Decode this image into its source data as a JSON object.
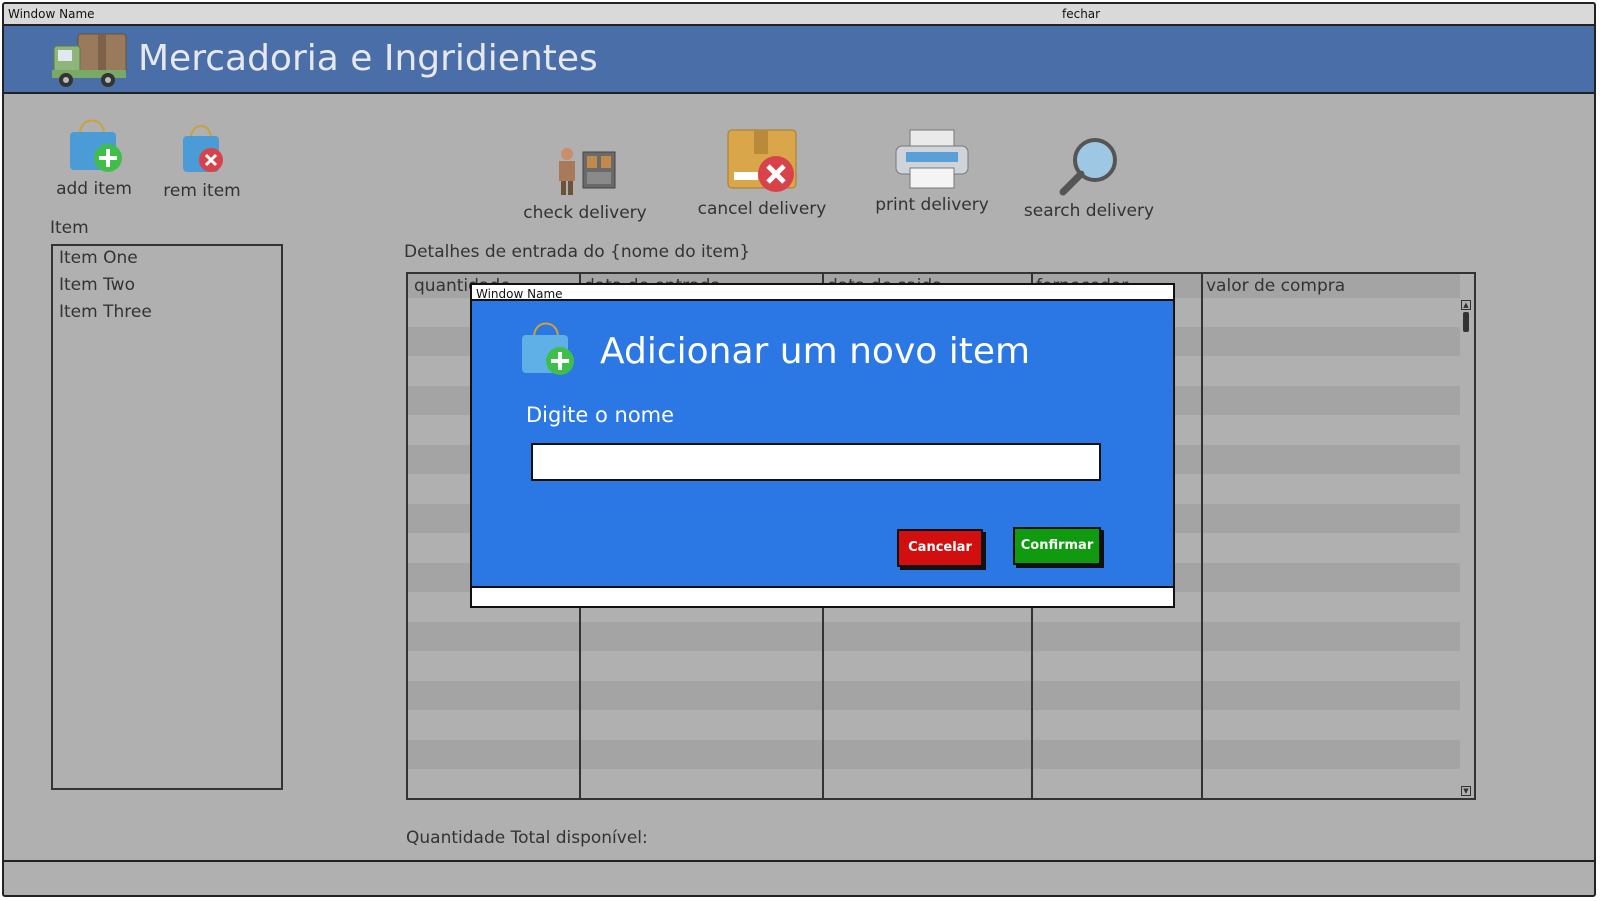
{
  "window": {
    "title": "Window Name",
    "close_label": "fechar"
  },
  "header": {
    "title": "Mercadoria e Ingridientes",
    "icon": "truck-icon"
  },
  "toolbar": {
    "add_item": "add item",
    "rem_item": "rem item",
    "check_delivery": "check delivery",
    "cancel_delivery": "cancel delivery",
    "print_delivery": "print delivery",
    "search_delivery": "search delivery"
  },
  "item_list": {
    "label": "Item",
    "items": [
      "Item One",
      "Item Two",
      "Item Three"
    ]
  },
  "details": {
    "title": "Detalhes de entrada do {nome do item}",
    "columns": [
      "quantidade",
      "data de entrada",
      "data de saida",
      "fornecedor",
      "valor de compra"
    ],
    "total_label": "Quantidade Total disponível:"
  },
  "dialog": {
    "window_title": "Window Name",
    "heading": "Adicionar um novo item",
    "field_label": "Digite o nome",
    "field_value": "",
    "cancel_label": "Cancelar",
    "confirm_label": "Confirmar",
    "colors": {
      "body": "#2b78e4",
      "cancel": "#d10f0f",
      "confirm": "#109a10"
    }
  }
}
